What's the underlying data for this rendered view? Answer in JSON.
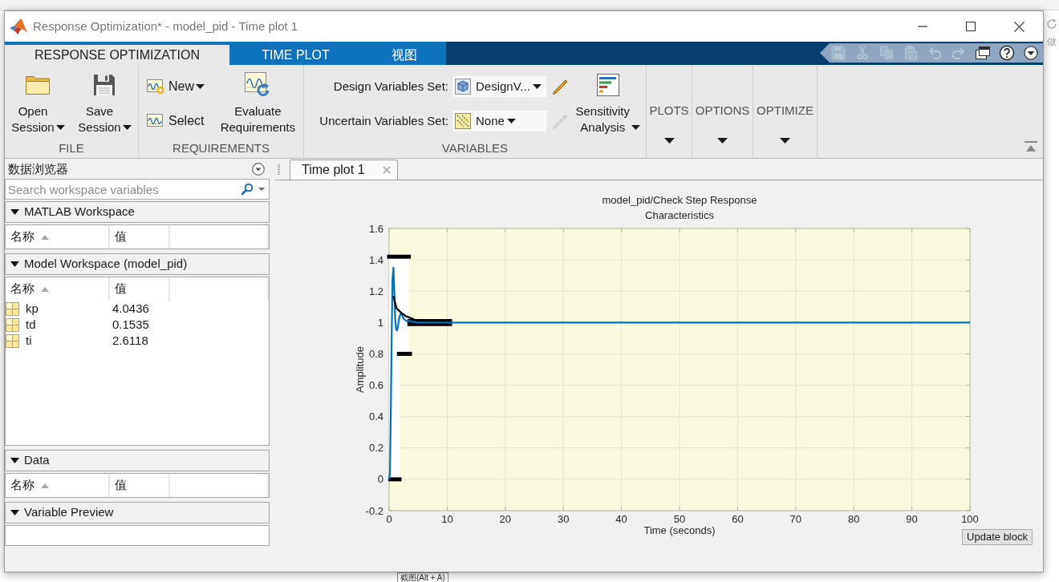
{
  "window": {
    "title": "Response Optimization* - model_pid - Time plot 1"
  },
  "ribbon_tabs": [
    {
      "label": "RESPONSE OPTIMIZATION",
      "selected": true
    },
    {
      "label": "TIME PLOT",
      "selected": false
    },
    {
      "label": "视图",
      "selected": false
    }
  ],
  "quick_access": [
    {
      "disabled": true
    },
    {
      "disabled": true
    },
    {
      "disabled": true
    },
    {
      "disabled": true
    },
    {
      "disabled": true
    },
    {
      "disabled": true
    },
    {
      "disabled": false
    },
    {
      "disabled": false
    },
    {
      "disabled": false
    }
  ],
  "toolstrip": {
    "file": {
      "label": "FILE",
      "buttons": [
        {
          "kind": "open",
          "label": "Open Session",
          "dropdown": true
        },
        {
          "kind": "save",
          "label": "Save Session",
          "dropdown": true
        }
      ]
    },
    "requirements": {
      "label": "REQUIREMENTS",
      "buttons": [
        {
          "kind": "new",
          "label": "New",
          "dropdown": true
        },
        {
          "kind": "select",
          "label": "Select",
          "dropdown": false
        },
        {
          "kind": "evaluate",
          "label": "Evaluate Requirements",
          "dropdown": false
        }
      ]
    },
    "variables": {
      "label": "VARIABLES",
      "sets": [
        {
          "kind": "design",
          "label": "Design Variables Set:",
          "value": "DesignV...",
          "editable": true
        },
        {
          "kind": "uncertain",
          "label": "Uncertain Variables Set:",
          "value": "None",
          "editable": false
        }
      ],
      "sensitivity": {
        "label": "Sensitivity Analysis",
        "dropdown": true
      }
    },
    "collapsed_sections": [
      {
        "label": "PLOTS"
      },
      {
        "label": "OPTIONS"
      },
      {
        "label": "OPTIMIZE"
      }
    ]
  },
  "data_browser": {
    "title": "数据浏览器",
    "search": {
      "placeholder": "Search workspace variables"
    },
    "sections": [
      {
        "kind": "table",
        "title": "MATLAB Workspace",
        "expanded": true,
        "columns": [
          {
            "label": "名称",
            "sorted": true
          },
          {
            "label": "值",
            "sorted": false
          }
        ]
      },
      {
        "kind": "table",
        "title": "Model Workspace (model_pid)",
        "expanded": true,
        "columns": [
          {
            "label": "名称",
            "sorted": true
          },
          {
            "label": "值",
            "sorted": false
          }
        ],
        "rows": [
          {
            "name": "kp",
            "value": "4.0436"
          },
          {
            "name": "td",
            "value": "0.1535"
          },
          {
            "name": "ti",
            "value": "2.6118"
          }
        ]
      },
      {
        "kind": "table",
        "title": "Data",
        "expanded": true,
        "columns": [
          {
            "label": "名称",
            "sorted": true
          },
          {
            "label": "值",
            "sorted": false
          }
        ]
      },
      {
        "kind": "preview",
        "title": "Variable Preview",
        "expanded": true
      }
    ]
  },
  "documents": {
    "tabs": [
      {
        "label": "Time plot 1",
        "selected": true
      }
    ],
    "update_button": "Update block",
    "chart_data": [
      {
        "type": "line",
        "title": "model_pid/Check Step Response Characteristics",
        "xlabel": "Time (seconds)",
        "ylabel": "Amplitude",
        "xlim": [
          0,
          100
        ],
        "ylim": [
          -0.2,
          1.6
        ],
        "xticks": [
          0,
          10,
          20,
          30,
          40,
          50,
          60,
          70,
          80,
          90,
          100
        ],
        "yticks": [
          -0.2,
          0,
          0.2,
          0.4,
          0.6,
          0.8,
          1,
          1.2,
          1.4,
          1.6
        ],
        "grid": true,
        "series": [
          {
            "type": "step",
            "color": "#000000",
            "x": [
              0,
              3.4
            ],
            "values": [
              1.42,
              1.42
            ]
          },
          {
            "type": "step",
            "color": "#000000",
            "x": [
              3.5,
              10.5
            ],
            "values": [
              1.01,
              1.01
            ]
          },
          {
            "type": "step",
            "color": "#000000",
            "x": [
              0.2,
              1.8
            ],
            "values": [
              0,
              0
            ]
          },
          {
            "type": "step",
            "color": "#000000",
            "x": [
              1.7,
              3.6
            ],
            "values": [
              0.8,
              0.8
            ]
          },
          {
            "type": "step",
            "color": "#000000",
            "x": [
              3.5,
              10.5
            ],
            "values": [
              0.99,
              0.99
            ]
          },
          {
            "type": "line",
            "color": "#0072bd",
            "x": [
              0,
              0.15,
              0.3,
              0.45,
              0.6,
              0.75,
              0.9,
              1.05,
              1.2,
              1.35,
              1.5,
              1.7,
              1.9,
              2.1,
              2.3,
              2.6,
              3,
              3.5,
              4,
              5,
              7,
              10,
              20,
              50,
              100
            ],
            "values": [
              0,
              0.05,
              0.45,
              0.95,
              1.28,
              1.35,
              1.2,
              1.02,
              0.96,
              0.95,
              0.97,
              1.02,
              1.05,
              1.06,
              1.04,
              1.02,
              1.01,
              1.01,
              1.005,
              1,
              1,
              1,
              1,
              1,
              1
            ]
          },
          {
            "type": "line",
            "color": "#000000",
            "x": [
              0.73,
              1.3,
              2,
              2.9,
              4.3
            ],
            "values": [
              1.17,
              1.09,
              1.065,
              1.04,
              1.02
            ]
          }
        ]
      }
    ]
  },
  "background": {
    "redo_label": "做",
    "tooltip": "截图(Alt + A)"
  }
}
